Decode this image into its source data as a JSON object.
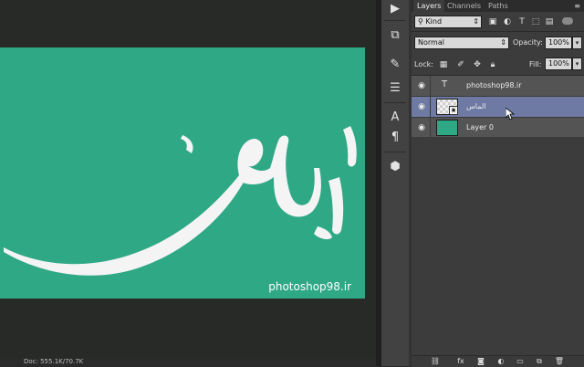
{
  "document": {
    "canvas_color": "#2fa886",
    "watermark_text": "photoshop98.ir",
    "calligraphy_text": "الماس"
  },
  "status_bar": {
    "doc_info": "Doc: 555.1K/70.7K"
  },
  "toolstrip": {
    "icons": [
      "play-icon",
      "layer-comps-icon",
      "brush-tool-icon",
      "adjustments-icon",
      "character-icon",
      "paragraph-icon",
      "3d-cube-icon"
    ]
  },
  "layers_panel": {
    "tabs": [
      {
        "label": "Layers",
        "active": true
      },
      {
        "label": "Channels",
        "active": false
      },
      {
        "label": "Paths",
        "active": false
      }
    ],
    "filter": {
      "kind_label": "Kind"
    },
    "blend_mode": "Normal",
    "opacity_label": "Opacity:",
    "opacity_value": "100%",
    "lock_label": "Lock:",
    "fill_label": "Fill:",
    "fill_value": "100%",
    "layers": [
      {
        "name": "photoshop98.ir",
        "type": "text",
        "visible": true,
        "selected": false
      },
      {
        "name": "الماس",
        "type": "smart-object",
        "visible": true,
        "selected": true
      },
      {
        "name": "Layer 0",
        "type": "pixel",
        "visible": true,
        "selected": false,
        "thumb_color": "#2fa886"
      }
    ],
    "bottom_icons": [
      "link-layers-icon",
      "fx-icon",
      "add-mask-icon",
      "adjustment-layer-icon",
      "new-group-icon",
      "new-layer-icon",
      "delete-layer-icon"
    ]
  },
  "colors": {
    "selected_row": "#6e7aa3",
    "panel_bg": "#3c3c3c",
    "layer_row": "#545454"
  }
}
